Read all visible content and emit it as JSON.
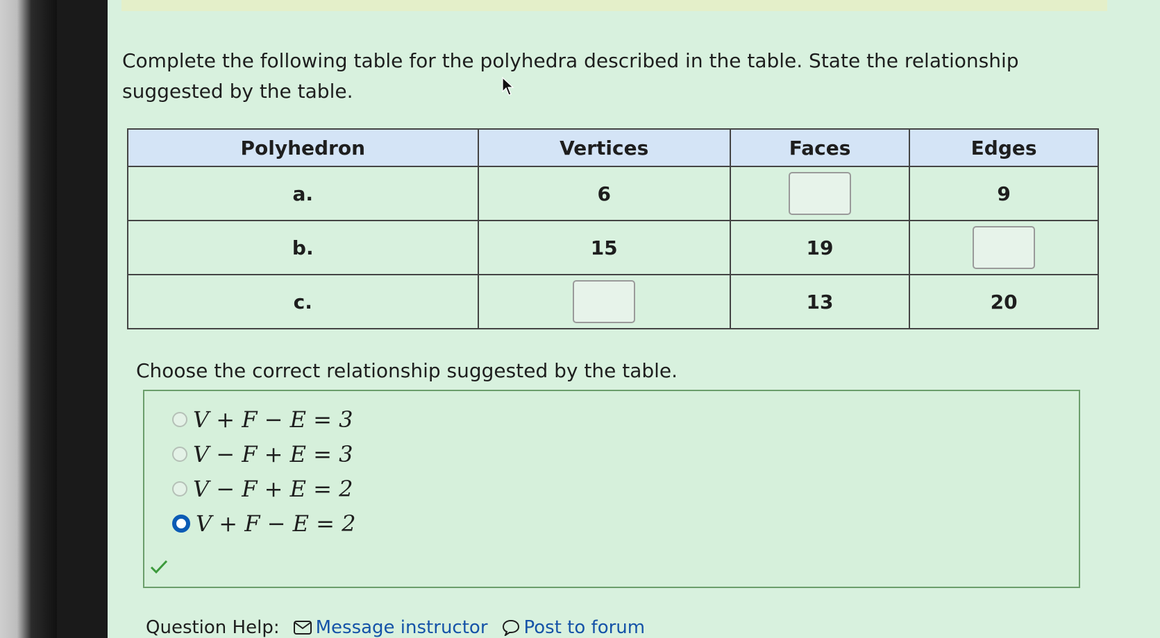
{
  "question": {
    "text": "Complete the following table for the polyhedra described in the table. State the relationship suggested by the table."
  },
  "table": {
    "headers": [
      "Polyhedron",
      "Vertices",
      "Faces",
      "Edges"
    ],
    "rows": [
      {
        "polyhedron": "a.",
        "vertices": "6",
        "faces": "",
        "edges": "9"
      },
      {
        "polyhedron": "b.",
        "vertices": "15",
        "faces": "19",
        "edges": ""
      },
      {
        "polyhedron": "c.",
        "vertices": "",
        "faces": "13",
        "edges": "20"
      }
    ]
  },
  "relationship": {
    "prompt": "Choose the correct relationship suggested by the table.",
    "options": [
      {
        "label": "V + F − E = 3",
        "selected": false
      },
      {
        "label": "V − F + E = 3",
        "selected": false
      },
      {
        "label": "V − F + E = 2",
        "selected": false
      },
      {
        "label": "V + F − E = 2",
        "selected": true
      }
    ]
  },
  "help": {
    "label": "Question Help:",
    "message_link": "Message instructor",
    "forum_link": "Post to forum"
  },
  "colors": {
    "page_bg": "#d8f1de",
    "header_bg": "#d4e4f6",
    "selected_radio": "#0b5bb5",
    "link": "#1553a8",
    "correct_check": "#3c9a3c"
  },
  "icons": [
    "mouse-cursor-icon",
    "correct-check-icon",
    "envelope-icon",
    "speech-bubble-icon"
  ]
}
